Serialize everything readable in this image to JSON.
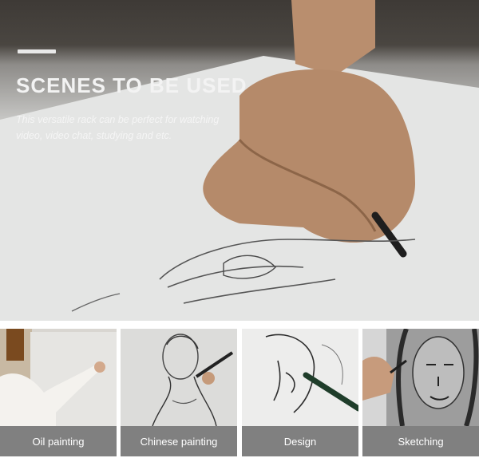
{
  "hero": {
    "title": "SCENES TO BE USED",
    "subtitle": "This versatile rack can be perfect for watching video, video chat, studying and etc."
  },
  "scenes": [
    {
      "label": "Oil painting"
    },
    {
      "label": "Chinese painting"
    },
    {
      "label": "Design"
    },
    {
      "label": "Sketching"
    }
  ]
}
